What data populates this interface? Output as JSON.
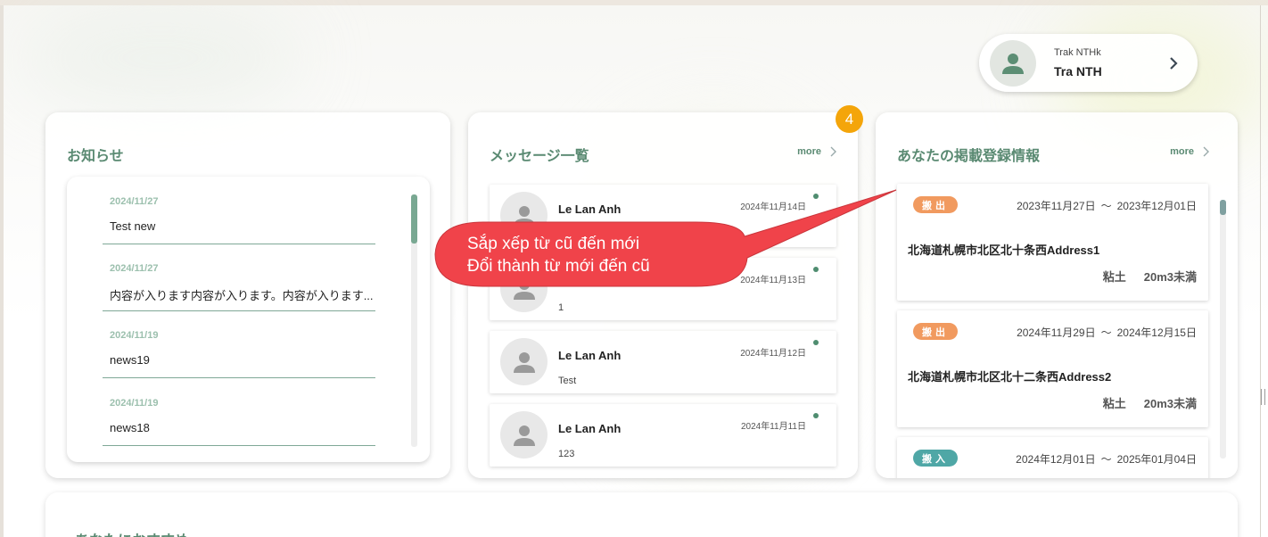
{
  "user": {
    "subname": "Trak NTHk",
    "name": "Tra NTH"
  },
  "news": {
    "title": "お知らせ",
    "items": [
      {
        "date": "2024/11/27",
        "title": "Test new"
      },
      {
        "date": "2024/11/27",
        "title": "内容が入ります内容が入ります。内容が入ります..."
      },
      {
        "date": "2024/11/19",
        "title": "news19"
      },
      {
        "date": "2024/11/19",
        "title": "news18"
      }
    ]
  },
  "messages": {
    "title": "メッセージ一覧",
    "more": "more",
    "badge": "4",
    "items": [
      {
        "name": "Le Lan Anh",
        "date": "2024年11月14日",
        "text": ""
      },
      {
        "name": "",
        "date": "2024年11月13日",
        "text": "1"
      },
      {
        "name": "Le Lan Anh",
        "date": "2024年11月12日",
        "text": "Test"
      },
      {
        "name": "Le Lan Anh",
        "date": "2024年11月11日",
        "text": "123"
      }
    ]
  },
  "registration": {
    "title": "あなたの掲載登録情報",
    "more": "more",
    "items": [
      {
        "tag": "搬出",
        "tag_color": "#f19a5f",
        "start": "2023年11月27日",
        "end": "2023年12月01日",
        "tilde": "～",
        "address": "北海道札幌市北区北十条西Address1",
        "soil": "粘土",
        "volume": "20m3未満"
      },
      {
        "tag": "搬出",
        "tag_color": "#f19a5f",
        "start": "2024年11月29日",
        "end": "2024年12月15日",
        "tilde": "～",
        "address": "北海道札幌市北区北十二条西Address2",
        "soil": "粘土",
        "volume": "20m3未満"
      },
      {
        "tag": "搬入",
        "tag_color": "#4fa7a6",
        "start": "2024年12月01日",
        "end": "2025年01月04日",
        "tilde": "～",
        "address": "",
        "soil": "",
        "volume": ""
      }
    ]
  },
  "recommend": {
    "title": "あなたにおすすめ"
  },
  "callout": {
    "line1": "Sắp xếp từ cũ đến mới",
    "line2": "Đổi thành từ mới đến cũ",
    "color": "#f0434a"
  },
  "colors": {
    "accent": "#5a8a72",
    "badge": "#f4a50a",
    "out_tag": "#f19a5f",
    "in_tag": "#4fa7a6"
  }
}
